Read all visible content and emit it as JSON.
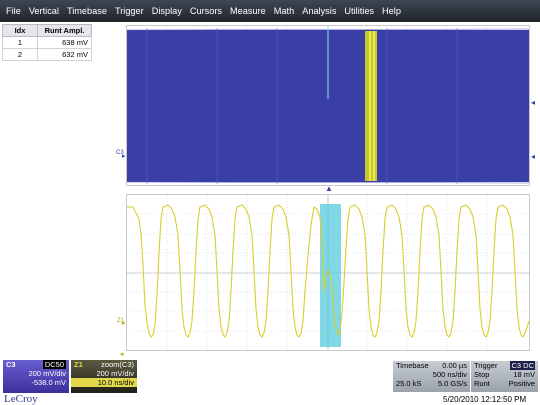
{
  "menu": [
    "File",
    "Vertical",
    "Timebase",
    "Trigger",
    "Display",
    "Cursors",
    "Measure",
    "Math",
    "Analysis",
    "Utilities",
    "Help"
  ],
  "measure_table": {
    "headers": [
      "Idx",
      "Runt Ampl."
    ],
    "rows": [
      [
        "1",
        "638 mV"
      ],
      [
        "2",
        "632 mV"
      ]
    ]
  },
  "trace_labels": {
    "top": "C3",
    "zoom": "Z1"
  },
  "channel_c3": {
    "name": "C3",
    "coupling": "DC50",
    "scale": "200 mV/div",
    "offset": "-538.0 mV"
  },
  "zoom_z1": {
    "name": "Z1",
    "source": "zoom(C3)",
    "scale": "200 mV/div",
    "time": "10.0 ns/div"
  },
  "timebase": {
    "label": "Timebase",
    "delay": "0.00 µs",
    "div": "500 ns/div",
    "samples": "25.0 kS",
    "rate": "5.0 GS/s"
  },
  "trigger": {
    "label": "Trigger",
    "channel": "C3 DC",
    "mode": "Stop",
    "level": "18 mV",
    "type": "Runt",
    "slope": "Positive"
  },
  "brand": "LeCroy",
  "timestamp": "5/20/2010 12:12:50 PM",
  "colors": {
    "trace_blue": "#3a3fa6",
    "trace_yellow": "#d8cf2a",
    "highlight_cyan": "#56c9dc",
    "menubar": "#2a3039"
  }
}
